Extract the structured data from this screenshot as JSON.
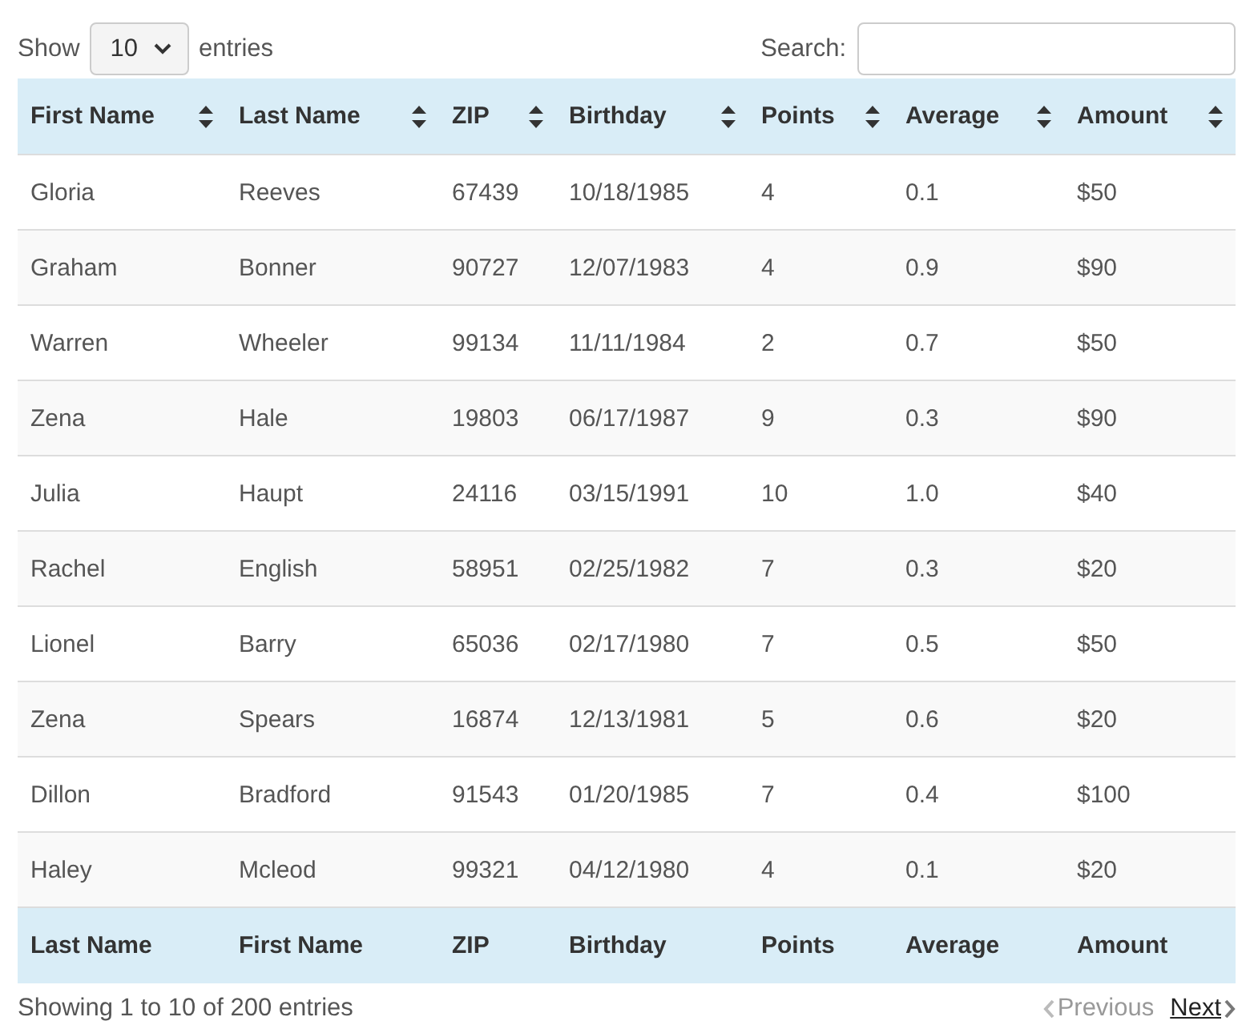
{
  "length_menu": {
    "label_before": "Show",
    "value": "10",
    "label_after": "entries"
  },
  "search": {
    "label": "Search:"
  },
  "table": {
    "columns": [
      "First Name",
      "Last Name",
      "ZIP",
      "Birthday",
      "Points",
      "Average",
      "Amount"
    ],
    "rows": [
      [
        "Gloria",
        "Reeves",
        "67439",
        "10/18/1985",
        "4",
        "0.1",
        "$50"
      ],
      [
        "Graham",
        "Bonner",
        "90727",
        "12/07/1983",
        "4",
        "0.9",
        "$90"
      ],
      [
        "Warren",
        "Wheeler",
        "99134",
        "11/11/1984",
        "2",
        "0.7",
        "$50"
      ],
      [
        "Zena",
        "Hale",
        "19803",
        "06/17/1987",
        "9",
        "0.3",
        "$90"
      ],
      [
        "Julia",
        "Haupt",
        "24116",
        "03/15/1991",
        "10",
        "1.0",
        "$40"
      ],
      [
        "Rachel",
        "English",
        "58951",
        "02/25/1982",
        "7",
        "0.3",
        "$20"
      ],
      [
        "Lionel",
        "Barry",
        "65036",
        "02/17/1980",
        "7",
        "0.5",
        "$50"
      ],
      [
        "Zena",
        "Spears",
        "16874",
        "12/13/1981",
        "5",
        "0.6",
        "$20"
      ],
      [
        "Dillon",
        "Bradford",
        "91543",
        "01/20/1985",
        "7",
        "0.4",
        "$100"
      ],
      [
        "Haley",
        "Mcleod",
        "99321",
        "04/12/1980",
        "4",
        "0.1",
        "$20"
      ]
    ],
    "footer": [
      "Last Name",
      "First Name",
      "ZIP",
      "Birthday",
      "Points",
      "Average",
      "Amount"
    ]
  },
  "info": "Showing 1 to 10 of 200 entries",
  "pager": [
    {
      "label": "Previous",
      "kind": "prev",
      "disabled": true
    },
    {
      "label": "Next",
      "kind": "next",
      "disabled": false
    }
  ]
}
